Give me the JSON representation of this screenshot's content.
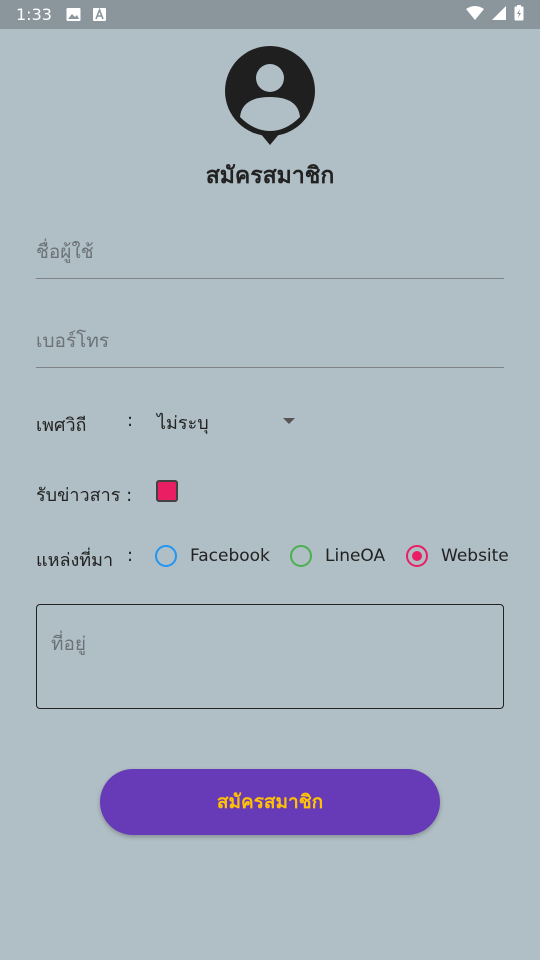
{
  "status_bar": {
    "time": "1:33"
  },
  "header": {
    "title": "สมัครสมาชิก",
    "avatar_icon": "person-pin-icon"
  },
  "form": {
    "username": {
      "value": "",
      "placeholder": "ชื่อผู้ใช้"
    },
    "phone": {
      "value": "",
      "placeholder": "เบอร์โทร"
    },
    "gender": {
      "label": "เพศวิถี",
      "colon": ":",
      "selected": "ไม่ระบุ"
    },
    "newsletter": {
      "label": "รับข่าวสาร :",
      "checked": true,
      "color": "#e91e63"
    },
    "source": {
      "label": "แหล่งที่มา",
      "colon": ":",
      "options": [
        {
          "label": "Facebook",
          "color": "#2196f3",
          "selected": false
        },
        {
          "label": "LineOA",
          "color": "#4caf50",
          "selected": false
        },
        {
          "label": "Website",
          "color": "#e91e63",
          "selected": true
        }
      ]
    },
    "address": {
      "value": "",
      "placeholder": "ที่อยู่"
    },
    "submit": {
      "label": "สมัครสมาชิก",
      "bg_color": "#673ab7",
      "text_color": "#ffc107"
    }
  }
}
